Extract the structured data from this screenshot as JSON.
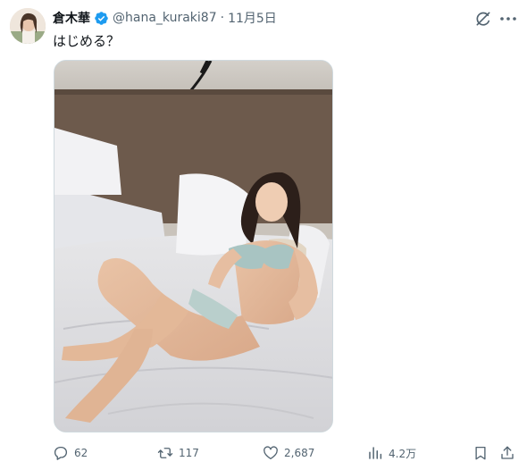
{
  "author": {
    "display_name": "倉木華",
    "handle": "@hana_kuraki87",
    "separator": "·",
    "date": "11月5日",
    "verified": true
  },
  "tweet": {
    "text": "はじめる？"
  },
  "icons": {
    "verified": "verified-badge-icon",
    "grok": "grok-icon",
    "more": "more-dots-icon",
    "reply": "reply-icon",
    "retweet": "retweet-icon",
    "like": "heart-icon",
    "views": "views-chart-icon",
    "bookmark": "bookmark-icon",
    "share": "share-icon"
  },
  "metrics": {
    "replies": "62",
    "retweets": "117",
    "likes": "2,687",
    "views": "4.2万"
  },
  "colors": {
    "verified_blue": "#1d9bf0",
    "secondary_text": "#536471",
    "primary_text": "#0f1419"
  }
}
